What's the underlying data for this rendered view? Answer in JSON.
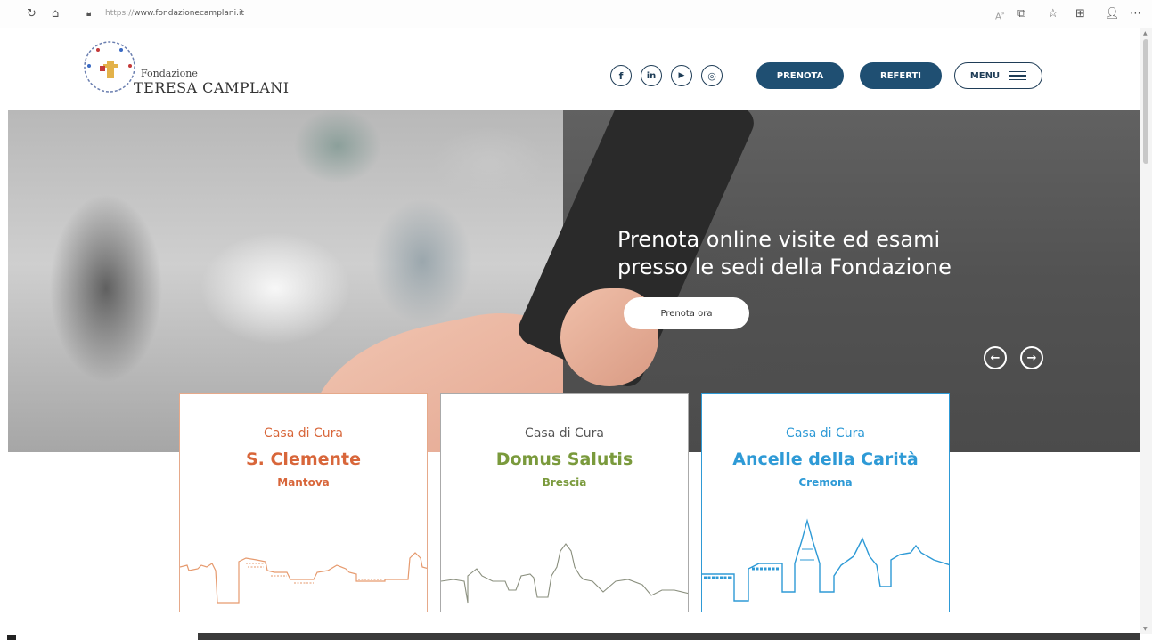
{
  "browser": {
    "url_proto": "https://",
    "url_host": "www.fondazionecamplani.it",
    "icons": [
      "reload-icon",
      "home-icon",
      "lock-icon",
      "read-aloud-icon",
      "tab-icon",
      "favorites-icon",
      "collections-icon",
      "profile-icon",
      "more-icon"
    ]
  },
  "header": {
    "logo_small": "Fondazione",
    "logo_big": "Teresa Camplani",
    "social": [
      "f",
      "in",
      "▶",
      "◎"
    ],
    "prenota_label": "PRENOTA",
    "referti_label": "REFERTI",
    "menu_label": "MENU"
  },
  "hero": {
    "title_line1": "Prenota online visite ed esami",
    "title_line2": "presso le sedi della Fondazione",
    "cta_label": "Prenota ora",
    "prev_label": "←",
    "next_label": "→"
  },
  "cards": [
    {
      "pre": "Casa di Cura",
      "name": "S. Clemente",
      "city": "Mantova",
      "color": "#d8663a"
    },
    {
      "pre": "Casa di Cura",
      "name": "Domus Salutis",
      "city": "Brescia",
      "color": "#7a9a3c"
    },
    {
      "pre": "Casa di Cura",
      "name": "Ancelle della Carità",
      "city": "Cremona",
      "color": "#2e9ad6"
    }
  ],
  "colors": {
    "navy": "#1f3d57",
    "button_blue": "#1f4f72"
  }
}
